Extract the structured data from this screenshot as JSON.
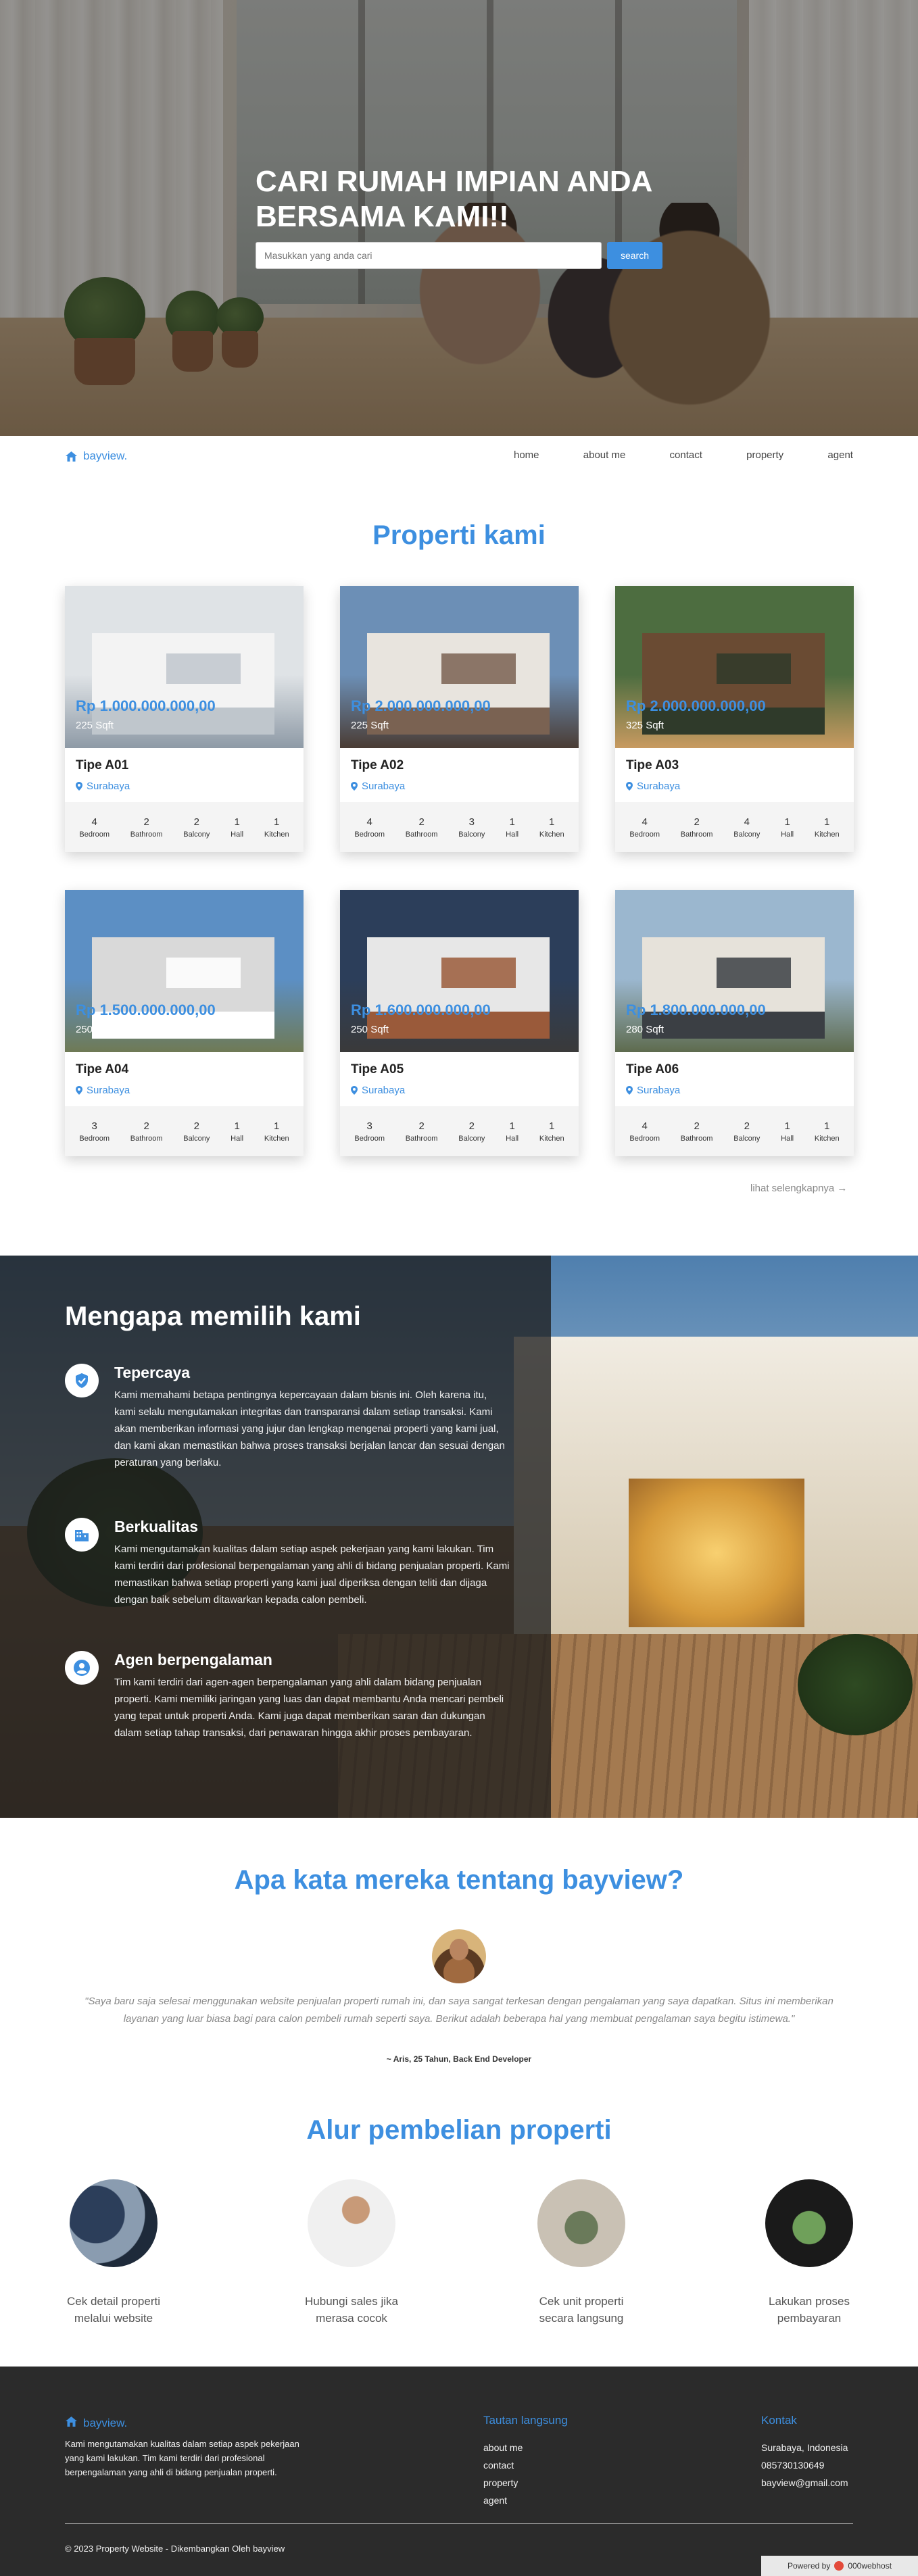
{
  "hero": {
    "title": "CARI RUMAH IMPIAN ANDA BERSAMA KAMI!!",
    "search_placeholder": "Masukkan yang anda cari",
    "search_button": "search"
  },
  "nav": {
    "brand": "bayview.",
    "links": [
      "home",
      "about me",
      "contact",
      "property",
      "agent"
    ]
  },
  "properties": {
    "title": "Properti kami",
    "see_more": "lihat selengkapnya →",
    "stat_labels": [
      "Bedroom",
      "Bathroom",
      "Balcony",
      "Hall",
      "Kitchen"
    ],
    "cards": [
      {
        "price": "Rp 1.000.000.000,00",
        "size": "225 Sqft",
        "name": "Tipe A01",
        "location": "Surabaya",
        "stats": [
          "4",
          "2",
          "2",
          "1",
          "1"
        ]
      },
      {
        "price": "Rp 2.000.000.000,00",
        "size": "225 Sqft",
        "name": "Tipe A02",
        "location": "Surabaya",
        "stats": [
          "4",
          "2",
          "3",
          "1",
          "1"
        ]
      },
      {
        "price": "Rp 2.000.000.000,00",
        "size": "325 Sqft",
        "name": "Tipe A03",
        "location": "Surabaya",
        "stats": [
          "4",
          "2",
          "4",
          "1",
          "1"
        ]
      },
      {
        "price": "Rp 1.500.000.000,00",
        "size": "250 Sqft",
        "name": "Tipe A04",
        "location": "Surabaya",
        "stats": [
          "3",
          "2",
          "2",
          "1",
          "1"
        ]
      },
      {
        "price": "Rp 1.600.000.000,00",
        "size": "250 Sqft",
        "name": "Tipe A05",
        "location": "Surabaya",
        "stats": [
          "3",
          "2",
          "2",
          "1",
          "1"
        ]
      },
      {
        "price": "Rp 1.800.000.000,00",
        "size": "280 Sqft",
        "name": "Tipe A06",
        "location": "Surabaya",
        "stats": [
          "4",
          "2",
          "2",
          "1",
          "1"
        ]
      }
    ]
  },
  "why": {
    "title": "Mengapa memilih kami",
    "items": [
      {
        "icon": "shield-check-icon",
        "title": "Tepercaya",
        "text": "Kami memahami betapa pentingnya kepercayaan dalam bisnis ini. Oleh karena itu, kami selalu mengutamakan integritas dan transparansi dalam setiap transaksi. Kami akan memberikan informasi yang jujur dan lengkap mengenai properti yang kami jual, dan kami akan memastikan bahwa proses transaksi berjalan lancar dan sesuai dengan peraturan yang berlaku."
      },
      {
        "icon": "building-icon",
        "title": "Berkualitas",
        "text": "Kami mengutamakan kualitas dalam setiap aspek pekerjaan yang kami lakukan. Tim kami terdiri dari profesional berpengalaman yang ahli di bidang penjualan properti. Kami memastikan bahwa setiap properti yang kami jual diperiksa dengan teliti dan dijaga dengan baik sebelum ditawarkan kepada calon pembeli."
      },
      {
        "icon": "user-icon",
        "title": "Agen berpengalaman",
        "text": "Tim kami terdiri dari agen-agen berpengalaman yang ahli dalam bidang penjualan properti. Kami memiliki jaringan yang luas dan dapat membantu Anda mencari pembeli yang tepat untuk properti Anda. Kami juga dapat memberikan saran dan dukungan dalam setiap tahap transaksi, dari penawaran hingga akhir proses pembayaran."
      }
    ]
  },
  "testimonial": {
    "title": "Apa kata mereka tentang bayview?",
    "quote": "\"Saya baru saja selesai menggunakan website penjualan properti rumah ini, dan saya sangat terkesan dengan pengalaman yang saya dapatkan. Situs ini memberikan layanan yang luar biasa bagi para calon pembeli rumah seperti saya. Berikut adalah beberapa hal yang membuat pengalaman saya begitu istimewa.\"",
    "author": "~ Aris, 25 Tahun, Back End Developer"
  },
  "flow": {
    "title": "Alur pembelian properti",
    "steps": [
      {
        "label_line1": "Cek detail properti",
        "label_line2": "melalui website"
      },
      {
        "label_line1": "Hubungi sales jika",
        "label_line2": "merasa cocok"
      },
      {
        "label_line1": "Cek unit properti",
        "label_line2": "secara langsung"
      },
      {
        "label_line1": "Lakukan proses",
        "label_line2": "pembayaran"
      }
    ]
  },
  "footer": {
    "brand": "bayview.",
    "description": "Kami mengutamakan kualitas dalam setiap aspek pekerjaan yang kami lakukan. Tim kami terdiri dari profesional berpengalaman yang ahli di bidang penjualan properti.",
    "links_title": "Tautan langsung",
    "links": [
      "about me",
      "contact",
      "property",
      "agent"
    ],
    "contact_title": "Kontak",
    "contact": [
      "Surabaya, Indonesia",
      "085730130649",
      "bayview@gmail.com"
    ],
    "copyright": "© 2023 Property Website - Dikembangkan Oleh bayview",
    "powered_prefix": "Powered by",
    "powered_brand": "000webhost"
  },
  "colors": {
    "accent": "#3d8fe0",
    "footer_bg": "#2b2b2b"
  }
}
